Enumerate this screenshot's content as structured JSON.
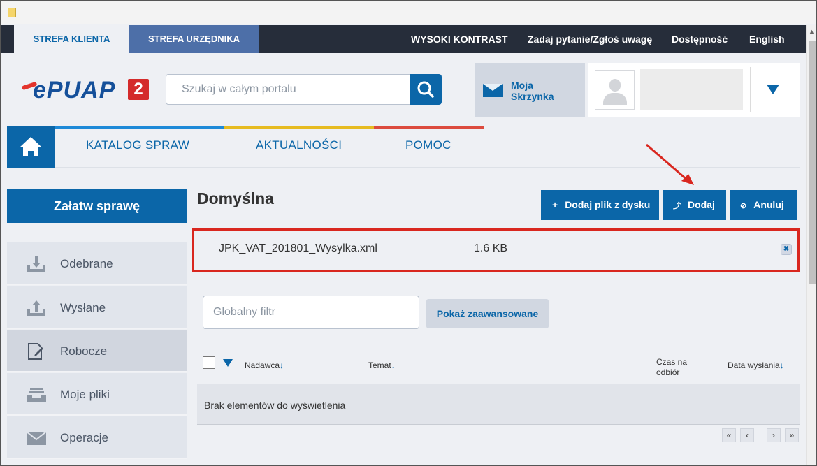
{
  "top_tabs": {
    "client": "STREFA KLIENTA",
    "official": "STREFA URZĘDNIKA"
  },
  "top_links": [
    "WYSOKI KONTRAST",
    "Zadaj pytanie/Zgłoś uwagę",
    "Dostępność",
    "English"
  ],
  "logo": {
    "text": "ePUAP",
    "badge": "2"
  },
  "search": {
    "placeholder": "Szukaj w całym portalu"
  },
  "mailbox": {
    "label": "Moja Skrzynka"
  },
  "nav": {
    "items": [
      "KATALOG SPRAW",
      "AKTUALNOŚCI",
      "POMOC"
    ],
    "stripe_colors": [
      "#1e8ad8",
      "#e6bb20",
      "#dc4b3e"
    ]
  },
  "sidebar": {
    "main_button": "Załatw sprawę",
    "items": [
      {
        "label": "Odebrane",
        "icon": "inbox-download-icon"
      },
      {
        "label": "Wysłane",
        "icon": "outbox-upload-icon"
      },
      {
        "label": "Robocze",
        "icon": "draft-edit-icon",
        "active": true
      },
      {
        "label": "Moje pliki",
        "icon": "files-tray-icon"
      },
      {
        "label": "Operacje",
        "icon": "envelope-icon"
      }
    ]
  },
  "main": {
    "title": "Domyślna",
    "buttons": {
      "add_from_disk": "Dodaj plik z dysku",
      "add": "Dodaj",
      "cancel": "Anuluj"
    },
    "file": {
      "name": "JPK_VAT_201801_Wysylka.xml",
      "size": "1.6 KB"
    },
    "filter": {
      "placeholder": "Globalny filtr"
    },
    "advanced_button": "Pokaż zaawansowane",
    "table": {
      "headers": {
        "sender": "Nadawca",
        "subject": "Temat",
        "time_line1": "Czas na",
        "time_line2": "odbiór",
        "sent_date": "Data wysłania"
      },
      "sort_arrow": "↓",
      "empty": "Brak elementów do wyświetlenia"
    },
    "pager": {
      "first": "«",
      "prev": "‹",
      "next": "›",
      "last": "»"
    }
  },
  "colors": {
    "primary": "#0b66a8",
    "topbar": "#262d3a",
    "highlight": "#d9271f"
  }
}
